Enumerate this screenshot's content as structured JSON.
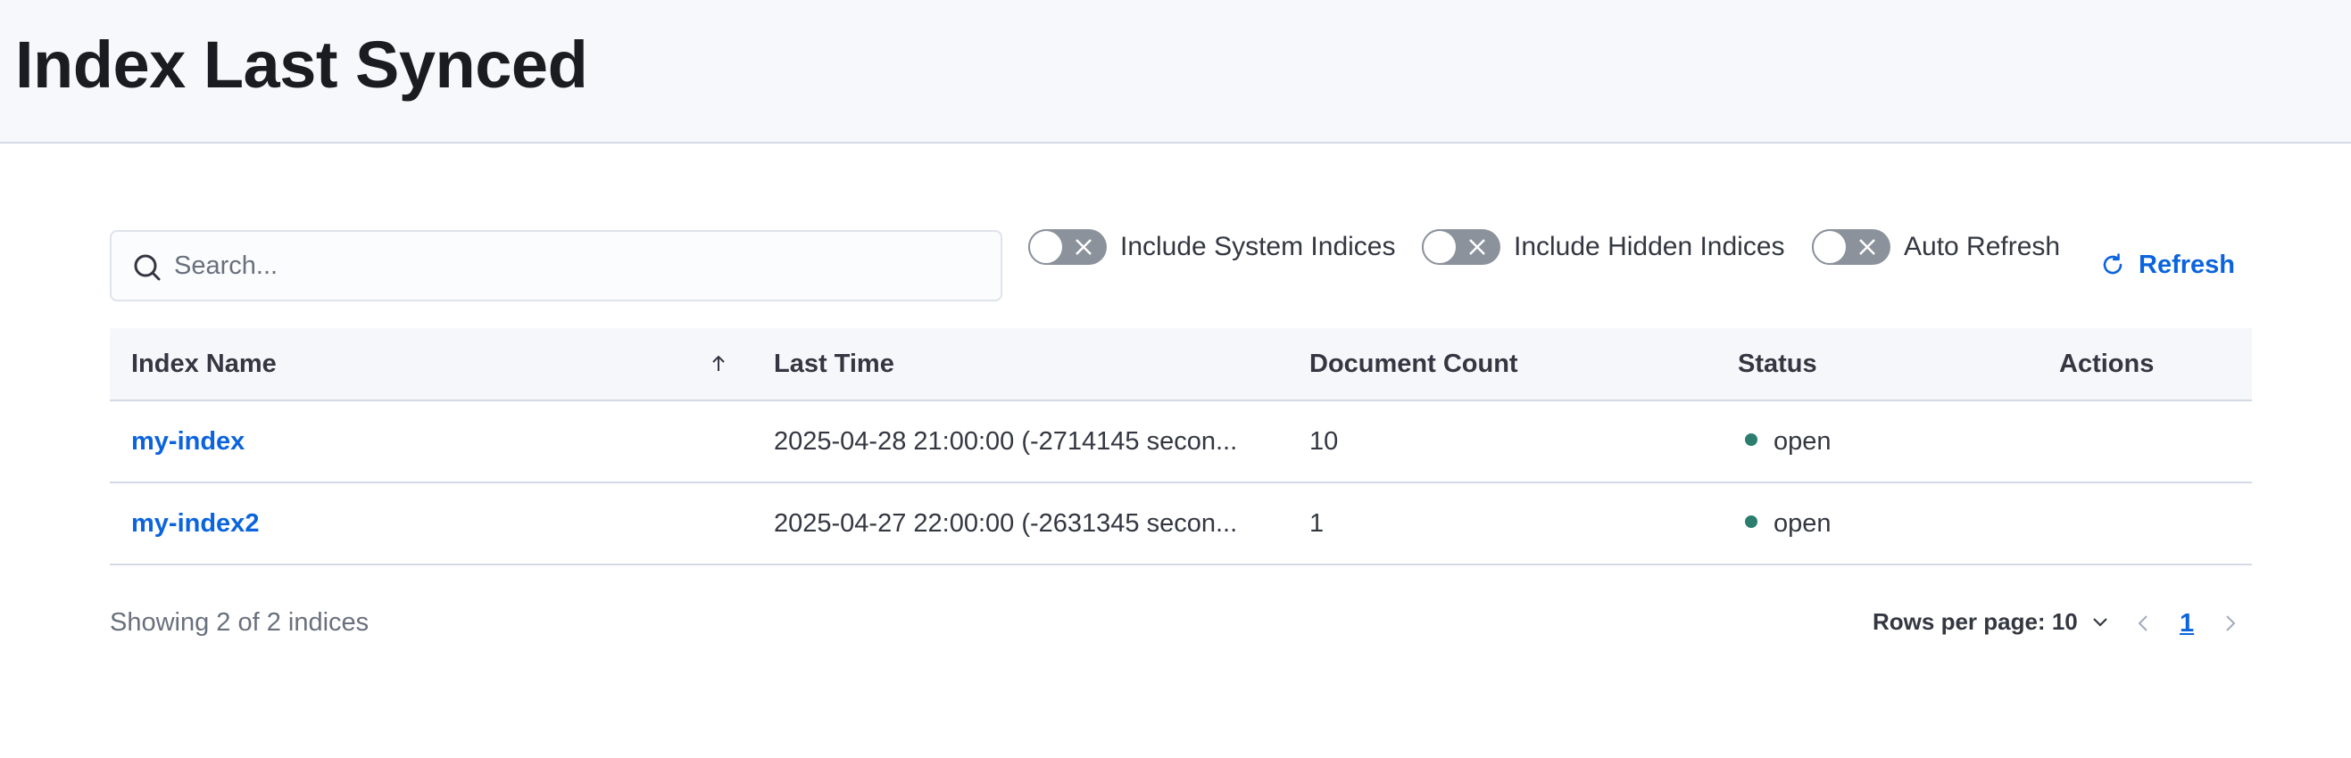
{
  "page": {
    "title": "Index Last Synced"
  },
  "toolbar": {
    "search_placeholder": "Search...",
    "search_value": "",
    "toggles": [
      {
        "label": "Include System Indices",
        "on": false
      },
      {
        "label": "Include Hidden Indices",
        "on": false
      },
      {
        "label": "Auto Refresh",
        "on": false
      }
    ],
    "refresh_label": "Refresh"
  },
  "table": {
    "columns": [
      "Index Name",
      "Last Time",
      "Document Count",
      "Status",
      "Actions"
    ],
    "rows": [
      {
        "index_name": "my-index",
        "last_time": "2025-04-28 21:00:00 (-2714145 secon...",
        "document_count": "10",
        "status": "open"
      },
      {
        "index_name": "my-index2",
        "last_time": "2025-04-27 22:00:00 (-2631345 secon...",
        "document_count": "1",
        "status": "open"
      }
    ]
  },
  "footer": {
    "showing_text": "Showing 2 of 2 indices",
    "rows_per_page": "Rows per page: 10",
    "current_page": "1"
  },
  "colors": {
    "link": "#0b64dd",
    "status_open": "#2b7d6e",
    "toggle_off": "#8c929c",
    "header_bg": "#f7f8fc"
  }
}
